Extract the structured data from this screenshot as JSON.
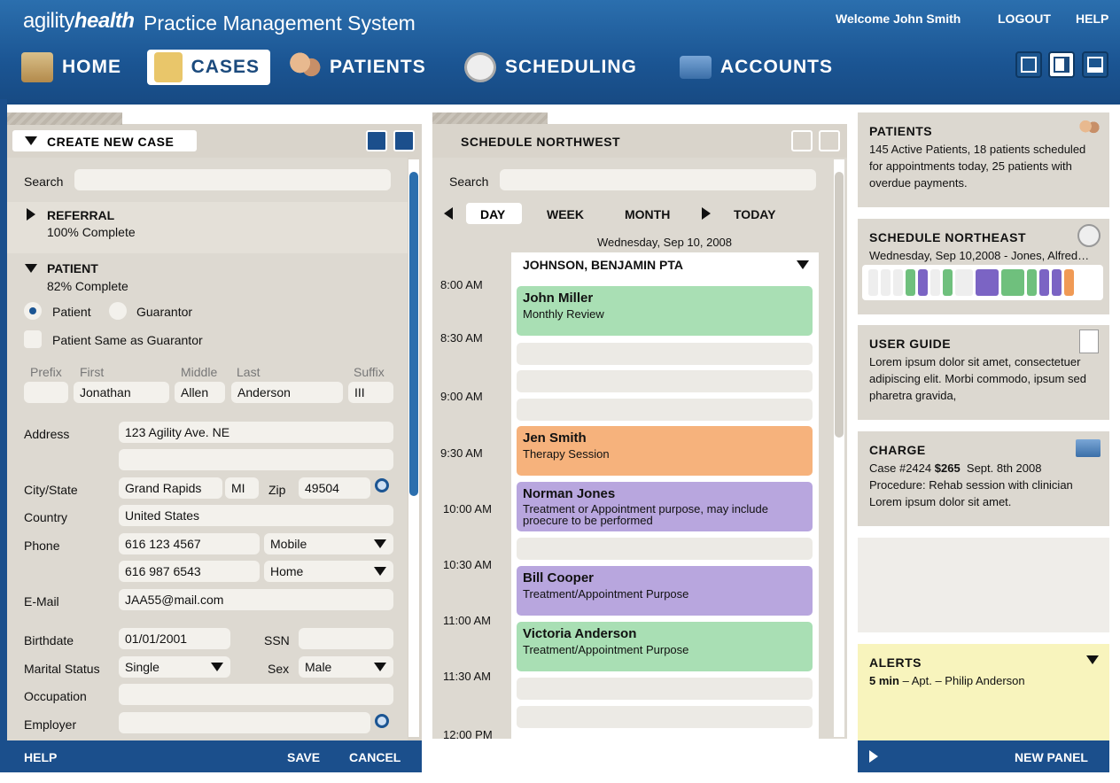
{
  "header": {
    "logo_prefix": "agility",
    "logo_suffix": "health",
    "title": "Practice Management System",
    "welcome": "Welcome John Smith",
    "logout": "LOGOUT",
    "help": "HELP"
  },
  "nav": [
    {
      "label": "HOME",
      "icon": "house-icon"
    },
    {
      "label": "CASES",
      "icon": "folder-icon",
      "active": true
    },
    {
      "label": "PATIENTS",
      "icon": "people-icon"
    },
    {
      "label": "SCHEDULING",
      "icon": "clock-icon"
    },
    {
      "label": "ACCOUNTS",
      "icon": "credit-card-icon"
    }
  ],
  "left": {
    "title": "CREATE NEW CASE",
    "search_label": "Search",
    "search_value": "",
    "referral": {
      "title": "REFERRAL",
      "status": "100% Complete"
    },
    "patient": {
      "title": "PATIENT",
      "status": "82% Complete",
      "radio1": "Patient",
      "radio2": "Guarantor",
      "check": "Patient Same as Guarantor"
    },
    "name_headers": {
      "prefix": "Prefix",
      "first": "First",
      "middle": "Middle",
      "last": "Last",
      "suffix": "Suffix"
    },
    "name_values": {
      "prefix": "",
      "first": "Jonathan",
      "middle": "Allen",
      "last": "Anderson",
      "suffix": "III"
    },
    "labels": {
      "address": "Address",
      "city": "City/State",
      "country": "Country",
      "phone": "Phone",
      "email": "E-Mail",
      "birthdate": "Birthdate",
      "ssn": "SSN",
      "marital": "Marital Status",
      "sex": "Sex",
      "occupation": "Occupation",
      "employer": "Employer",
      "zip": "Zip"
    },
    "values": {
      "address1": "123 Agility Ave. NE",
      "address2": "",
      "city": "Grand Rapids",
      "state": "MI",
      "zip": "49504",
      "country": "United States",
      "phone1": "616 123 4567",
      "phone1_type": "Mobile",
      "phone2": "616 987 6543",
      "phone2_type": "Home",
      "email": "JAA55@mail.com",
      "birthdate": "01/01/2001",
      "ssn": "",
      "marital": "Single",
      "sex": "Male",
      "occupation": "",
      "employer": ""
    },
    "footer": {
      "help": "HELP",
      "save": "SAVE",
      "cancel": "CANCEL"
    }
  },
  "schedule": {
    "title": "SCHEDULE NORTHWEST",
    "search_label": "Search",
    "tabs": [
      "DAY",
      "WEEK",
      "MONTH"
    ],
    "today": "TODAY",
    "date": "Wednesday, Sep 10, 2008",
    "provider": "JOHNSON, BENJAMIN PTA",
    "times": [
      "8:00 AM",
      "8:30 AM",
      "9:00 AM",
      "9:30 AM",
      "10:00 AM",
      "10:30 AM",
      "11:00 AM",
      "11:30 AM",
      "12:00 PM"
    ],
    "appointments": [
      {
        "name": "John Miller",
        "purpose": "Monthly Review",
        "color": "#a9dfb4"
      },
      {
        "name": "Jen Smith",
        "purpose": "Therapy Session",
        "color": "#f6b27c"
      },
      {
        "name": "Norman Jones",
        "purpose": "Treatment or Appointment purpose, may include proecure to be performed",
        "color": "#b8a6de"
      },
      {
        "name": "Bill Cooper",
        "purpose": "Treatment/Appointment Purpose",
        "color": "#b8a6de"
      },
      {
        "name": "Victoria Anderson",
        "purpose": "Treatment/Appointment Purpose",
        "color": "#a9dfb4"
      }
    ]
  },
  "right": {
    "patients": {
      "title": "PATIENTS",
      "text": "145 Active Patients, 18 patients scheduled for appointments today, 25 patients with overdue payments."
    },
    "schedule_ne": {
      "title": "SCHEDULE NORTHEAST",
      "text": "Wednesday, Sep 10,2008 - Jones, Alfred…"
    },
    "guide": {
      "title": "USER GUIDE",
      "text": "Lorem ipsum dolor sit amet, consectetuer adipiscing elit. Morbi commodo, ipsum sed pharetra gravida,"
    },
    "charge": {
      "title": "CHARGE",
      "case": "Case #2424",
      "amount": "$265",
      "date": "Sept. 8th 2008",
      "line2": "Procedure: Rehab session with clinician Lorem ipsum dolor sit amet."
    },
    "alerts": {
      "title": "ALERTS",
      "time": "5 min",
      "text": "– Apt. – Philip Anderson"
    },
    "footer": {
      "new_panel": "NEW PANEL"
    }
  }
}
